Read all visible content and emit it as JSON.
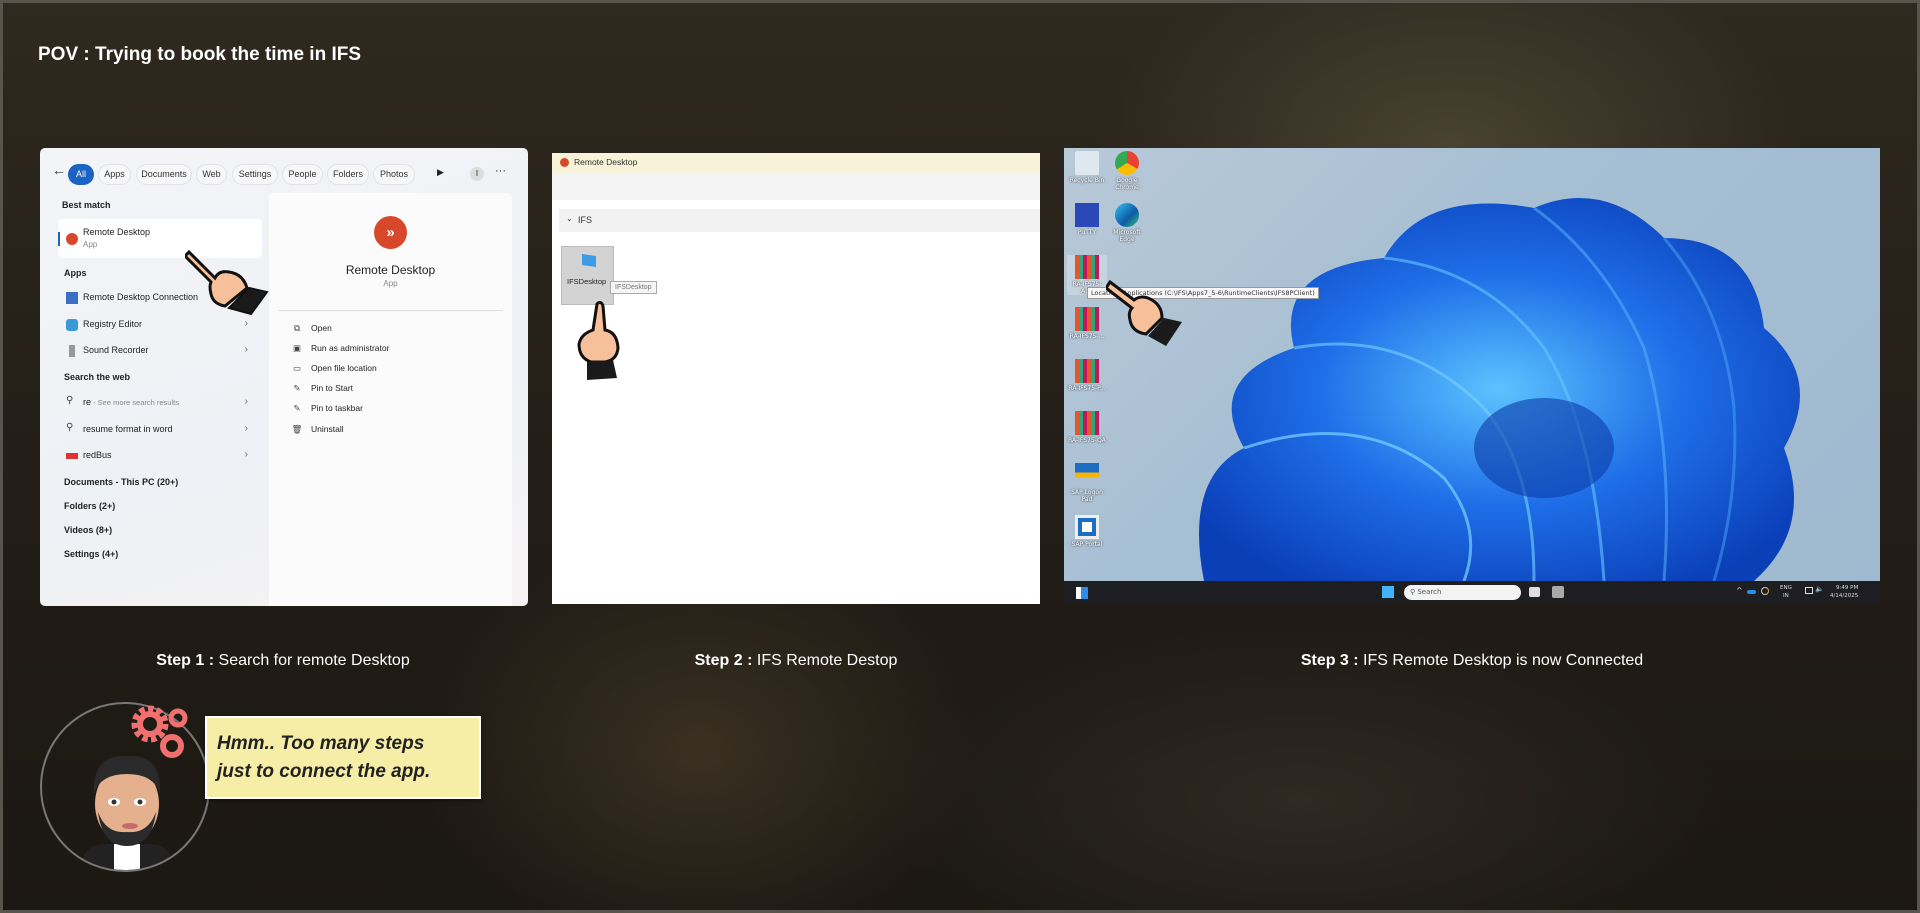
{
  "header": {
    "title": "POV : Trying to book the time in IFS"
  },
  "step1": {
    "filters": [
      "All",
      "Apps",
      "Documents",
      "Web",
      "Settings",
      "People",
      "Folders",
      "Photos"
    ],
    "profile_initial": "I",
    "best_match_label": "Best match",
    "best_match": {
      "title": "Remote Desktop",
      "subtitle": "App"
    },
    "apps_label": "Apps",
    "apps": [
      "Remote Desktop Connection",
      "Registry Editor",
      "Sound Recorder"
    ],
    "web_label": "Search the web",
    "web": [
      {
        "query": "re",
        "hint": " - See more search results"
      },
      {
        "query": "resume format in word",
        "hint": ""
      },
      {
        "query": "redBus",
        "hint": ""
      }
    ],
    "categories": [
      "Documents - This PC (20+)",
      "Folders (2+)",
      "Videos (8+)",
      "Settings (4+)"
    ],
    "detail": {
      "title": "Remote Desktop",
      "subtitle": "App",
      "actions": [
        "Open",
        "Run as administrator",
        "Open file location",
        "Pin to Start",
        "Pin to taskbar",
        "Uninstall"
      ]
    }
  },
  "step2": {
    "window_title": "Remote Desktop",
    "group": "IFS",
    "tile": "IFSDesktop",
    "tooltip": "IFSDesktop"
  },
  "step3": {
    "icons": [
      "Recycle Bin",
      "Google Chrome",
      "PuTTY",
      "Microsoft Edge",
      "RA-IFS75-App",
      "RA-IFS75-...",
      "RA-IFS75-P...",
      "RA-IFS75-QA",
      "SAP Logon Pad",
      "SAP Portal"
    ],
    "tooltip": "Location: Applications (C:\\IFS\\Apps7_5-6\\RuntimeClients\\IFS8PClient)",
    "taskbar": {
      "search": "Search",
      "lang": "ENG",
      "region": "IN",
      "time": "9:49 PM",
      "date": "4/14/2025"
    }
  },
  "captions": [
    {
      "step": "Step 1 :",
      "text": " Search for remote Desktop"
    },
    {
      "step": "Step 2 :",
      "text": " IFS Remote Destop"
    },
    {
      "step": "Step 3 :",
      "text": " IFS Remote Desktop is now Connected"
    }
  ],
  "bubble": {
    "line1": "Hmm.. Too many steps",
    "line2": "just to connect the app."
  },
  "colors": {
    "accent": "#1b63c3",
    "rdp_red": "#d9472b",
    "bubble": "#f6eda6",
    "gears": "#f07070"
  }
}
